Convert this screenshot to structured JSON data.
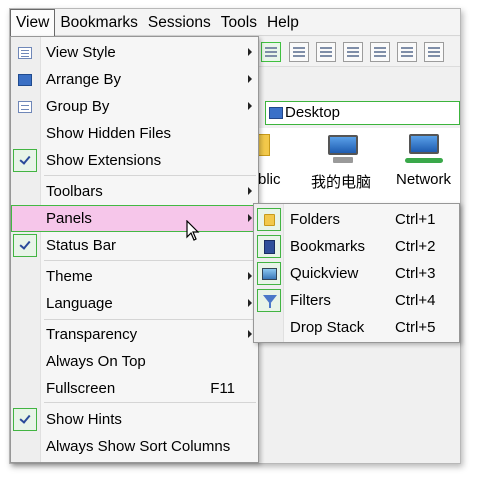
{
  "menubar": {
    "items": [
      {
        "label": "View",
        "active": true
      },
      {
        "label": "Bookmarks"
      },
      {
        "label": "Sessions"
      },
      {
        "label": "Tools"
      },
      {
        "label": "Help"
      }
    ]
  },
  "address_bar": {
    "value": "Desktop"
  },
  "desktop_items": [
    {
      "label": "blic",
      "icon": "folder-icon"
    },
    {
      "label": "我的电脑",
      "icon": "computer-icon"
    },
    {
      "label": "Network",
      "icon": "network-icon"
    }
  ],
  "view_menu": {
    "items": [
      {
        "label": "View Style",
        "submenu": true,
        "icon": "view-style-icon"
      },
      {
        "label": "Arrange By",
        "submenu": true,
        "icon": "arrange-icon"
      },
      {
        "label": "Group By",
        "submenu": true,
        "icon": "group-icon"
      },
      {
        "label": "Show Hidden Files"
      },
      {
        "label": "Show Extensions",
        "checked": true
      },
      {
        "label": "Toolbars",
        "submenu": true
      },
      {
        "label": "Panels",
        "submenu": true,
        "highlighted": true
      },
      {
        "label": "Status Bar",
        "checked": true
      },
      {
        "label": "Theme",
        "submenu": true
      },
      {
        "label": "Language",
        "submenu": true
      },
      {
        "label": "Transparency",
        "submenu": true
      },
      {
        "label": "Always On Top"
      },
      {
        "label": "Fullscreen",
        "shortcut": "F11"
      },
      {
        "label": "Show Hints",
        "checked": true
      },
      {
        "label": "Always Show Sort Columns"
      }
    ]
  },
  "panels_submenu": {
    "items": [
      {
        "label": "Folders",
        "shortcut": "Ctrl+1",
        "icon": "folder-icon"
      },
      {
        "label": "Bookmarks",
        "shortcut": "Ctrl+2",
        "icon": "bookmark-icon"
      },
      {
        "label": "Quickview",
        "shortcut": "Ctrl+3",
        "icon": "picture-icon"
      },
      {
        "label": "Filters",
        "shortcut": "Ctrl+4",
        "icon": "filter-icon"
      },
      {
        "label": "Drop Stack",
        "shortcut": "Ctrl+5"
      }
    ]
  },
  "colors": {
    "highlight": "#f6c6ea",
    "check_border": "#44b844",
    "menu_bg": "#f6f6f6"
  }
}
